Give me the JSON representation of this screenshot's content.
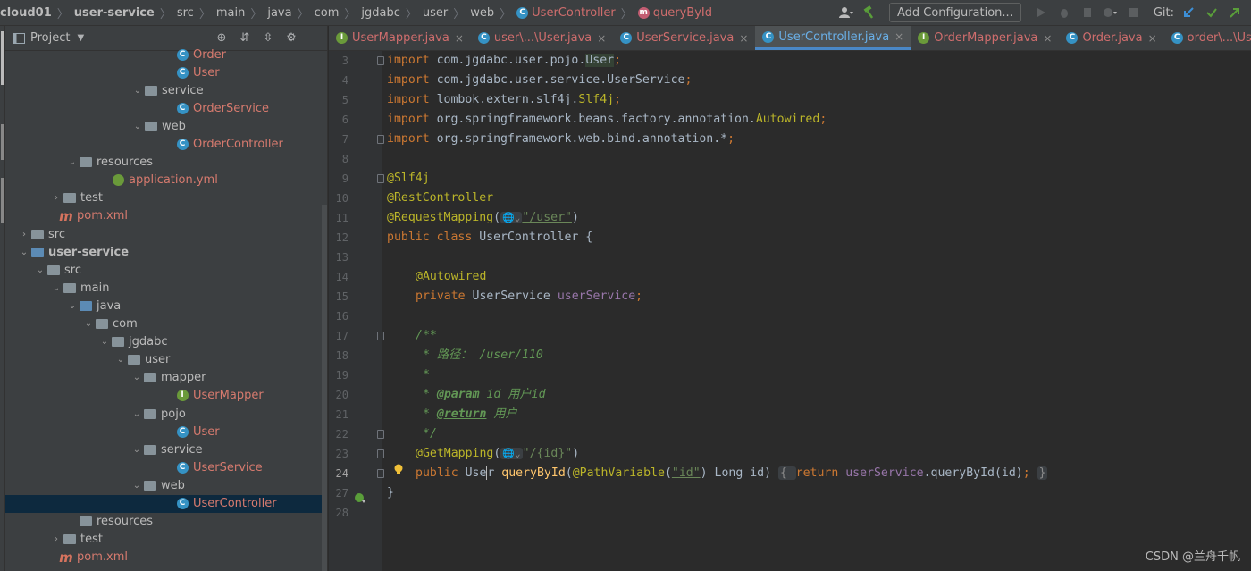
{
  "navbar": {
    "breadcrumbs": [
      "cloud01",
      "user-service",
      "src",
      "main",
      "java",
      "com",
      "jgdabc",
      "user",
      "web",
      "UserController",
      "queryById"
    ],
    "add_configuration": "Add Configuration...",
    "git_label": "Git:"
  },
  "project_panel": {
    "title": "Project",
    "tree": [
      {
        "label": "Order",
        "indent": 190,
        "type": "class",
        "red": true
      },
      {
        "label": "User",
        "indent": 190,
        "type": "class",
        "red": true
      },
      {
        "label": "service",
        "indent": 155,
        "type": "folder",
        "arrow": "open"
      },
      {
        "label": "OrderService",
        "indent": 190,
        "type": "class",
        "red": true
      },
      {
        "label": "web",
        "indent": 155,
        "type": "folder",
        "arrow": "open"
      },
      {
        "label": "OrderController",
        "indent": 190,
        "type": "class",
        "red": true
      },
      {
        "label": "resources",
        "indent": 82,
        "type": "folder",
        "arrow": "open"
      },
      {
        "label": "application.yml",
        "indent": 118,
        "type": "yml",
        "red": true
      },
      {
        "label": "test",
        "indent": 64,
        "type": "folder",
        "arrow": "closed"
      },
      {
        "label": "pom.xml",
        "indent": 60,
        "type": "maven",
        "red": true
      },
      {
        "label": "src",
        "indent": 28,
        "type": "folder",
        "arrow": "closed"
      },
      {
        "label": "user-service",
        "indent": 28,
        "type": "module",
        "arrow": "open",
        "bold": true
      },
      {
        "label": "src",
        "indent": 46,
        "type": "folder",
        "arrow": "open"
      },
      {
        "label": "main",
        "indent": 64,
        "type": "folder",
        "arrow": "open"
      },
      {
        "label": "java",
        "indent": 82,
        "type": "folder-blue",
        "arrow": "open"
      },
      {
        "label": "com",
        "indent": 100,
        "type": "folder",
        "arrow": "open"
      },
      {
        "label": "jgdabc",
        "indent": 118,
        "type": "folder",
        "arrow": "open"
      },
      {
        "label": "user",
        "indent": 136,
        "type": "folder",
        "arrow": "open"
      },
      {
        "label": "mapper",
        "indent": 154,
        "type": "folder",
        "arrow": "open"
      },
      {
        "label": "UserMapper",
        "indent": 190,
        "type": "interface",
        "red": true
      },
      {
        "label": "pojo",
        "indent": 154,
        "type": "folder",
        "arrow": "open"
      },
      {
        "label": "User",
        "indent": 190,
        "type": "class",
        "red": true
      },
      {
        "label": "service",
        "indent": 154,
        "type": "folder",
        "arrow": "open"
      },
      {
        "label": "UserService",
        "indent": 190,
        "type": "class",
        "red": true
      },
      {
        "label": "web",
        "indent": 154,
        "type": "folder",
        "arrow": "open"
      },
      {
        "label": "UserController",
        "indent": 190,
        "type": "class",
        "red": true,
        "selected": true
      },
      {
        "label": "resources",
        "indent": 82,
        "type": "folder",
        "arrow": "none"
      },
      {
        "label": "test",
        "indent": 64,
        "type": "folder",
        "arrow": "closed"
      },
      {
        "label": "pom.xml",
        "indent": 60,
        "type": "maven",
        "red": true
      }
    ]
  },
  "tabs": [
    {
      "label": "UserMapper.java",
      "icon": "interface"
    },
    {
      "label": "user\\...\\User.java",
      "icon": "class"
    },
    {
      "label": "UserService.java",
      "icon": "class"
    },
    {
      "label": "UserController.java",
      "icon": "class",
      "active": true
    },
    {
      "label": "OrderMapper.java",
      "icon": "interface"
    },
    {
      "label": "Order.java",
      "icon": "class"
    },
    {
      "label": "order\\...\\User.java",
      "icon": "class"
    }
  ],
  "line_numbers": [
    "3",
    "4",
    "5",
    "6",
    "7",
    "8",
    "9",
    "10",
    "11",
    "12",
    "13",
    "14",
    "15",
    "16",
    "17",
    "18",
    "19",
    "20",
    "21",
    "22",
    "23",
    "24",
    "27",
    "28"
  ],
  "code": {
    "l3_import": "import ",
    "l3_pkg": "com.jgdabc.user.pojo.",
    "l3_cls": "User",
    "l3_end": ";",
    "l4_import": "import ",
    "l4_body": "com.jgdabc.user.service.UserService",
    "l4_end": ";",
    "l5_import": "import ",
    "l5_pkg": "lombok.extern.slf4j.",
    "l5_cls": "Slf4j",
    "l5_end": ";",
    "l6_import": "import ",
    "l6_pkg": "org.springframework.beans.factory.annotation.",
    "l6_cls": "Autowired",
    "l6_end": ";",
    "l7_import": "import ",
    "l7_body": "org.springframework.web.bind.annotation.*",
    "l7_end": ";",
    "l9": "@Slf4j",
    "l10": "@RestController",
    "l11_ann": "@RequestMapping",
    "l11_open": "(",
    "l11_str": "\"/user\"",
    "l11_close": ")",
    "l12_kw": "public class ",
    "l12_name": "UserController {",
    "l14": "@Autowired",
    "l15_kw": "private ",
    "l15_type": "UserService ",
    "l15_fld": "userService",
    "l15_end": ";",
    "l17": "/**",
    "l18": "* 路径： /user/110",
    "l19": "*",
    "l20_star": "* ",
    "l20_tag": "@param",
    "l20_rest": " id 用户id",
    "l21_star": "* ",
    "l21_tag": "@return",
    "l21_rest": " 用户",
    "l22": "*/",
    "l23_ann": "@GetMapping",
    "l23_open": "(",
    "l23_str": "\"/{id}\"",
    "l23_close": ")",
    "l24_kw": "public ",
    "l24_type_a": "Use",
    "l24_type_b": "r ",
    "l24_fn": "queryById",
    "l24_params_a": "(",
    "l24_pv": "@PathVariable",
    "l24_pv_open": "(",
    "l24_pv_str": "\"id\"",
    "l24_pv_close": ") Long id) ",
    "l24_ob": "{ ",
    "l24_ret": "return ",
    "l24_fld": "userService",
    "l24_call": ".queryById(id)",
    "l24_semi": "; ",
    "l24_cb": "}",
    "l27": "}"
  },
  "watermark": "CSDN @兰舟千帆"
}
